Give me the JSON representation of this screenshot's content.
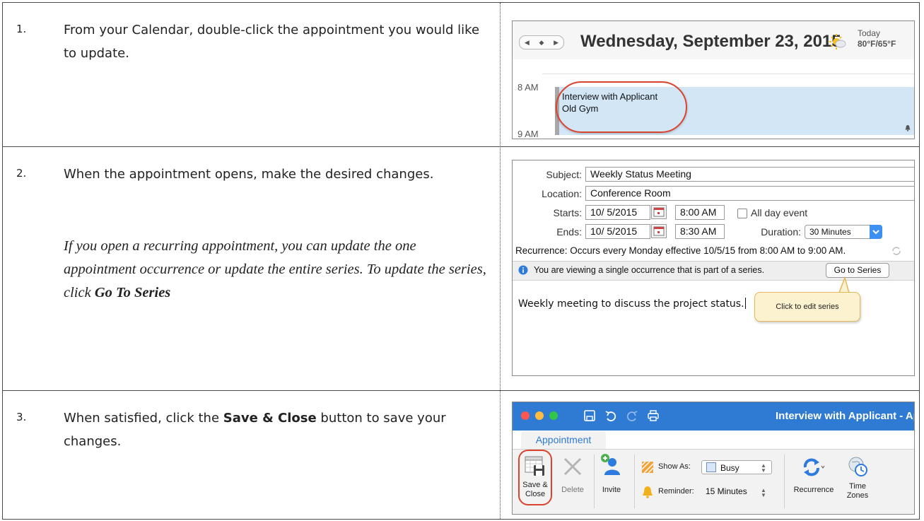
{
  "steps": [
    {
      "number": "1.",
      "text": "From your Calendar, double-click the appointment you would like to update."
    },
    {
      "number": "2.",
      "text": "When the appointment opens, make the desired changes.",
      "note_text": "If you open a recurring appointment, you can update the one appointment occurrence or update the entire series.  To update the series, click ",
      "note_bold": "Go To Series"
    },
    {
      "number": "3.",
      "text_before": "When satisfied, click the ",
      "text_bold": "Save & Close",
      "text_after": " button to save your changes."
    }
  ],
  "calendar": {
    "date": "Wednesday, September 23, 2015",
    "weather_label": "Today",
    "weather_temp": "80°F/65°F",
    "hour_8": "8 AM",
    "hour_9": "9 AM",
    "event_title": "Interview with Applicant",
    "event_location": "Old Gym"
  },
  "appointment_form": {
    "subject_label": "Subject:",
    "subject_value": "Weekly Status Meeting",
    "location_label": "Location:",
    "location_value": "Conference Room",
    "starts_label": "Starts:",
    "starts_date": "10/ 5/2015",
    "starts_time": "8:00 AM",
    "all_day_label": "All day event",
    "ends_label": "Ends:",
    "ends_date": "10/ 5/2015",
    "ends_time": "8:30 AM",
    "duration_label": "Duration:",
    "duration_value": "30 Minutes",
    "recurrence_text": "Recurrence: Occurs every Monday effective 10/5/15 from 8:00 AM to 9:00 AM.",
    "info_text": "You are viewing a single occurrence that is part of a series.",
    "go_to_series_label": "Go to Series",
    "body_text": "Weekly meeting to discuss the project status.",
    "callout_text": "Click to edit series"
  },
  "ribbon": {
    "window_title": "Interview with Applicant - Appo",
    "tab_label": "Appointment",
    "save_close_line1": "Save &",
    "save_close_line2": "Close",
    "delete_label": "Delete",
    "invite_label": "Invite",
    "show_as_label": "Show As:",
    "show_as_value": "Busy",
    "reminder_label": "Reminder:",
    "reminder_value": "15 Minutes",
    "recurrence_label": "Recurrence",
    "time_zones_line1": "Time",
    "time_zones_line2": "Zones"
  },
  "colors": {
    "highlight_circle": "#d9442f",
    "title_bar": "#2f7ad3",
    "event_fill": "#d3e6f6",
    "callout_fill": "#fdf2cf"
  },
  "icons": [
    "sun-icon",
    "bell-icon",
    "calendar-picker-icon",
    "info-icon",
    "refresh-icon",
    "save-close-icon",
    "delete-icon",
    "invite-icon",
    "show-as-icon",
    "reminder-bell-icon",
    "recurrence-icon",
    "time-zones-icon",
    "save-icon",
    "undo-icon",
    "redo-icon",
    "print-icon"
  ]
}
